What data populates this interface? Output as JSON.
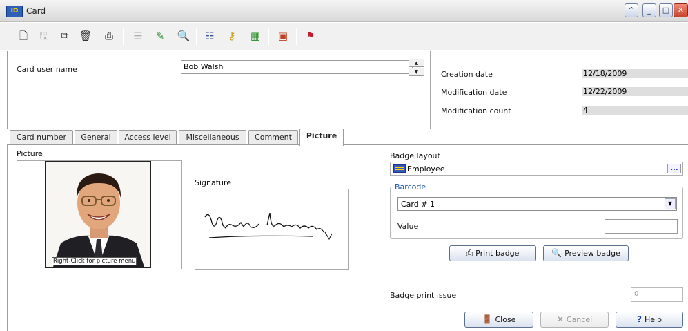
{
  "window": {
    "title": "Card",
    "app_icon_text": "ID"
  },
  "colors": {
    "titlebar": "#e4e4e4",
    "barcode_legend": "#1d4fb0",
    "close_red": "#c8442c"
  },
  "toolbar": {
    "icons": [
      "new-icon",
      "save-icon",
      "copy-icon",
      "delete-icon",
      "print-icon",
      "list-icon",
      "link-icon",
      "find-icon",
      "filter-icon",
      "key-icon",
      "grid-icon",
      "floppy-icon",
      "flag-icon"
    ]
  },
  "card": {
    "user_name_label": "Card user name",
    "user_name_value": "Bob Walsh",
    "creation_date_label": "Creation date",
    "creation_date_value": "12/18/2009",
    "modification_date_label": "Modification date",
    "modification_date_value": "12/22/2009",
    "modification_count_label": "Modification count",
    "modification_count_value": "4"
  },
  "tabs": [
    {
      "label": "Card number"
    },
    {
      "label": "General"
    },
    {
      "label": "Access level"
    },
    {
      "label": "Miscellaneous"
    },
    {
      "label": "Comment"
    },
    {
      "label": "Picture",
      "active": true
    }
  ],
  "picture": {
    "label": "Picture",
    "caption": "Right-Click for picture menu",
    "signature_label": "Signature"
  },
  "badge": {
    "layout_label": "Badge layout",
    "layout_value": "Employee",
    "browse_label": "...",
    "barcode_legend": "Barcode",
    "barcode_selected": "Card # 1",
    "value_label": "Value",
    "value_text": "",
    "print_button": "Print badge",
    "preview_button": "Preview badge",
    "print_issue_label": "Badge print issue",
    "print_issue_value": "0"
  },
  "footer": {
    "close_button": "Close",
    "cancel_button": "Cancel",
    "help_button": "Help"
  }
}
